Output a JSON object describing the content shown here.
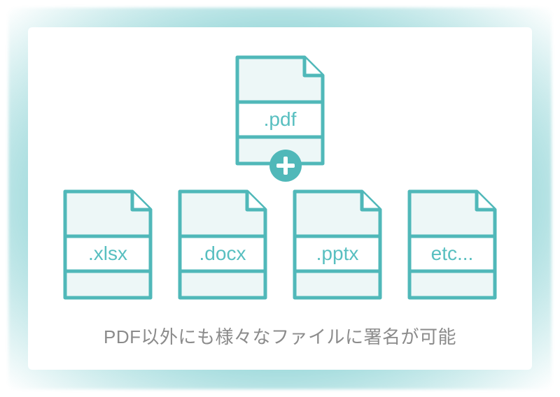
{
  "colors": {
    "accent": "#50b8b9",
    "icon_fill": "#edf7f7",
    "page_fill": "#ffffff",
    "text_muted": "#8b8b8b"
  },
  "top_file": {
    "label": ".pdf",
    "name": "pdf"
  },
  "bottom_files": [
    {
      "label": ".xlsx",
      "name": "xlsx"
    },
    {
      "label": ".docx",
      "name": "docx"
    },
    {
      "label": ".pptx",
      "name": "pptx"
    },
    {
      "label": "etc...",
      "name": "etc"
    }
  ],
  "caption": "PDF以外にも様々なファイルに署名が可能"
}
